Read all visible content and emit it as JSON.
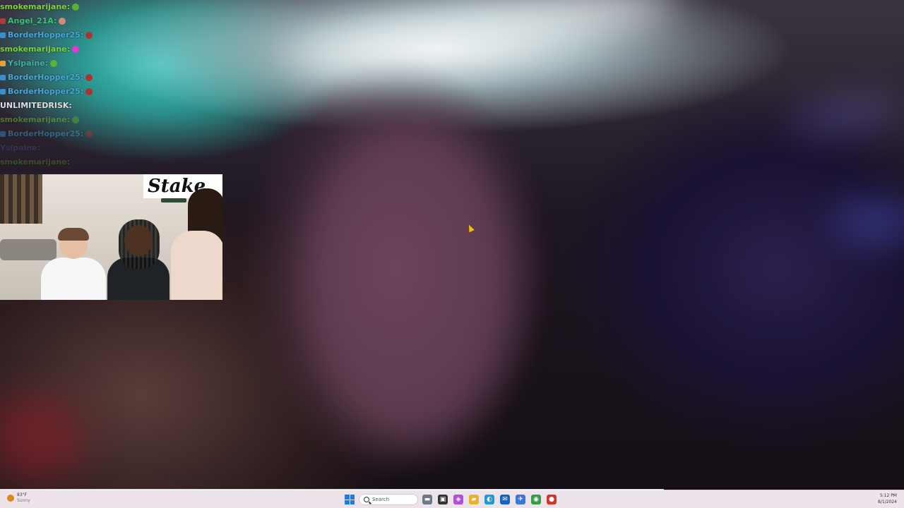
{
  "chat": {
    "lines": [
      {
        "user": "smokemarijane:",
        "color": "#7fd13b",
        "badge": "",
        "emote": "#5bb232",
        "fade": ""
      },
      {
        "user": "Angel_21A:",
        "color": "#3fbf7a",
        "badge": "#b33a3a",
        "emote": "#d38b7a",
        "fade": ""
      },
      {
        "user": "BorderHopper25:",
        "color": "#4aa3d8",
        "badge": "#3a8fd0",
        "emote": "#a33",
        "fade": ""
      },
      {
        "user": "smokemarijane:",
        "color": "#7fd13b",
        "badge": "",
        "emote": "#e03ad0",
        "fade": ""
      },
      {
        "user": "Yslpaine:",
        "color": "#45b0a0",
        "badge": "#e8a23a",
        "emote": "#5bb232",
        "fade": ""
      },
      {
        "user": "BorderHopper25:",
        "color": "#4aa3d8",
        "badge": "#3a8fd0",
        "emote": "#a33",
        "fade": ""
      },
      {
        "user": "BorderHopper25:",
        "color": "#4aa3d8",
        "badge": "#3a8fd0",
        "emote": "#a33",
        "fade": ""
      },
      {
        "user": "UNLIMITEDRISK:",
        "color": "#dddddd",
        "badge": "",
        "emote": "",
        "fade": ""
      },
      {
        "user": "smokemarijane:",
        "color": "#7fd13b",
        "badge": "",
        "emote": "#5bb232",
        "fade": "dim"
      },
      {
        "user": "BorderHopper25:",
        "color": "#4aa3d8",
        "badge": "#3a8fd0",
        "emote": "#a33",
        "fade": "dim"
      },
      {
        "user": "Yslpaine:",
        "color": "#7b5cd0",
        "badge": "",
        "emote": "",
        "fade": "dimmer"
      },
      {
        "user": "smokemarijane:",
        "color": "#7fd13b",
        "badge": "",
        "emote": "",
        "fade": "dimmer"
      }
    ]
  },
  "webcam": {
    "sign_text": "Stake"
  },
  "taskbar": {
    "weather": {
      "temp": "83°F",
      "condition": "Sunny"
    },
    "search_placeholder": "Search",
    "icons": [
      {
        "name": "widgets-icon",
        "color": "#6a7a8a",
        "glyph": "▬"
      },
      {
        "name": "task-view-icon",
        "color": "#333333",
        "glyph": "▣"
      },
      {
        "name": "copilot-icon",
        "color": "#b14fd8",
        "glyph": "◈"
      },
      {
        "name": "file-explorer-icon",
        "color": "#e8b52a",
        "glyph": "▰"
      },
      {
        "name": "edge-icon",
        "color": "#1f9ad6",
        "glyph": "◐"
      },
      {
        "name": "outlook-icon",
        "color": "#1565c0",
        "glyph": "✉"
      },
      {
        "name": "store-icon",
        "color": "#3a78d8",
        "glyph": "✈"
      },
      {
        "name": "chrome-icon",
        "color": "#2f9e44",
        "glyph": "◉"
      },
      {
        "name": "app-icon",
        "color": "#d0372f",
        "glyph": "●"
      }
    ],
    "time": "5:12 PM",
    "date": "8/1/2024"
  },
  "colors": {
    "taskbar_bg": "#ece4ea",
    "start_blue": "#1f7be0",
    "cursor_yellow": "#f2c200"
  }
}
